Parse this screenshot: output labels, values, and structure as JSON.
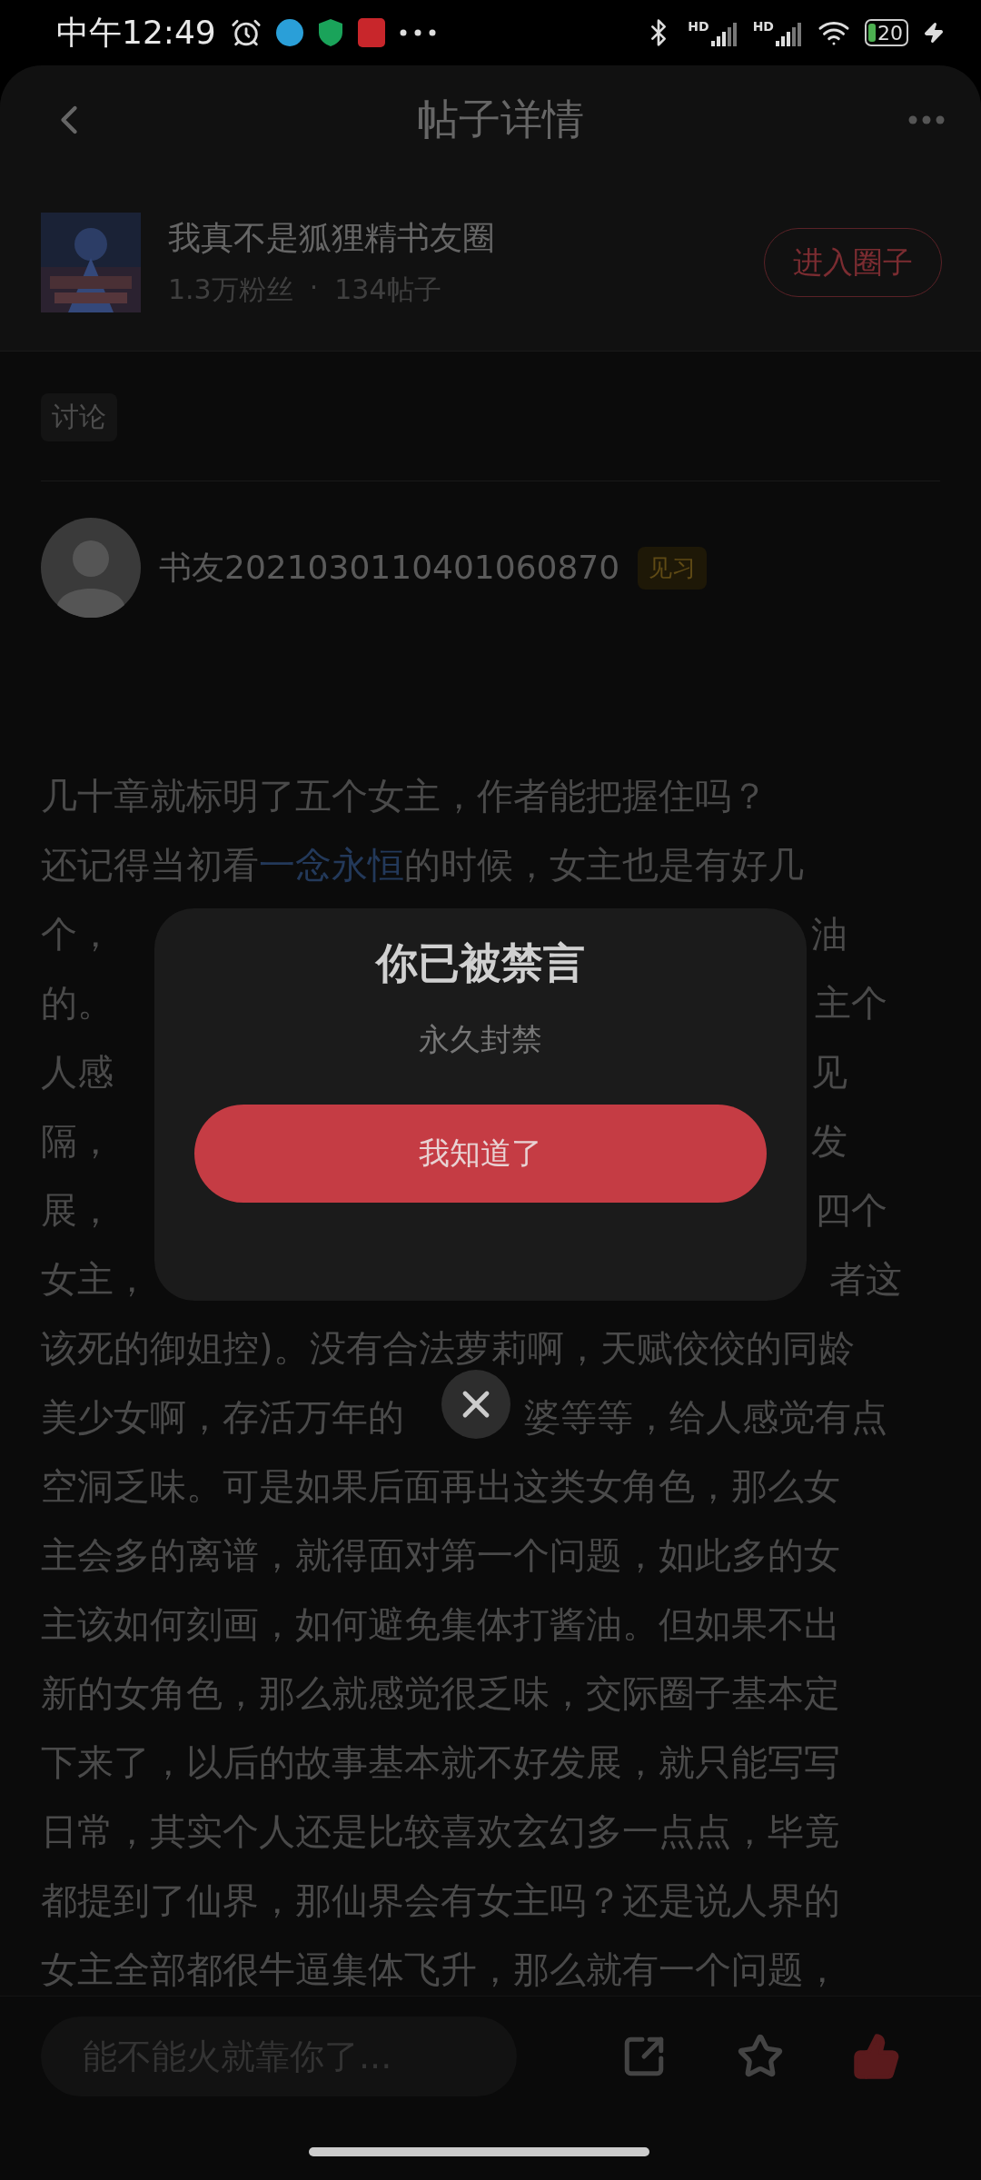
{
  "status_bar": {
    "time": "中午12:49",
    "signals": [
      {
        "label": "HD"
      },
      {
        "label": "HD"
      }
    ],
    "battery": "20"
  },
  "header": {
    "title": "帖子详情"
  },
  "circle": {
    "name": "我真不是狐狸精书友圈",
    "fans": "1.3万粉丝",
    "separator": "·",
    "posts": "134帖子",
    "join_button": "进入圈子"
  },
  "tag": "讨论",
  "author": {
    "name": "书友2021030110401060870",
    "badge": "见习"
  },
  "body_lines": [
    {
      "segments": [
        {
          "kind": "text",
          "text": "几十章就标明了五个女主，作者能把握住吗？"
        }
      ]
    },
    {
      "segments": [
        {
          "kind": "text",
          "text": "还记得当初看"
        },
        {
          "kind": "link",
          "text": "一念永恒"
        },
        {
          "kind": "text",
          "text": "的时候，女主也是有好几"
        }
      ]
    },
    {
      "segments": [
        {
          "kind": "text",
          "text": "个，"
        }
      ],
      "after_gap": "油"
    },
    {
      "segments": [
        {
          "kind": "text",
          "text": "的。"
        }
      ],
      "after_gap": "主个"
    },
    {
      "segments": [
        {
          "kind": "text",
          "text": "人感"
        }
      ],
      "after_gap": "见"
    },
    {
      "segments": [
        {
          "kind": "text",
          "text": "隔，"
        }
      ],
      "after_gap": "发"
    },
    {
      "segments": [
        {
          "kind": "text",
          "text": "展，"
        }
      ],
      "after_gap": "四个"
    },
    {
      "segments": [
        {
          "kind": "text",
          "text": "女主，"
        }
      ],
      "after_gap": "者这"
    },
    {
      "segments": [
        {
          "kind": "text",
          "text": "该死的御姐控)。没有合法萝莉啊，天赋佼佼的同龄"
        }
      ]
    },
    {
      "segments": [
        {
          "kind": "text",
          "text": "美少女啊，存活万年的"
        }
      ],
      "after_gap": "婆等等，给人感觉有点"
    },
    {
      "segments": [
        {
          "kind": "text",
          "text": "空洞乏味。可是如果后面再出这类女角色，那么女"
        }
      ]
    },
    {
      "segments": [
        {
          "kind": "text",
          "text": "主会多的离谱，就得面对第一个问题，如此多的女"
        }
      ]
    },
    {
      "segments": [
        {
          "kind": "text",
          "text": "主该如何刻画，如何避免集体打酱油。但如果不出"
        }
      ]
    },
    {
      "segments": [
        {
          "kind": "text",
          "text": "新的女角色，那么就感觉很乏味，交际圈子基本定"
        }
      ]
    },
    {
      "segments": [
        {
          "kind": "text",
          "text": "下来了，以后的故事基本就不好发展，就只能写写"
        }
      ]
    },
    {
      "segments": [
        {
          "kind": "text",
          "text": "日常，其实个人还是比较喜欢玄幻多一点点，毕竟"
        }
      ]
    },
    {
      "segments": [
        {
          "kind": "text",
          "text": "都提到了仙界，那仙界会有女主吗？还是说人界的"
        }
      ]
    },
    {
      "segments": [
        {
          "kind": "text",
          "text": "女主全部都很牛逼集体飞升，那么就有一个问题，"
        }
      ]
    }
  ],
  "comment_input": {
    "placeholder": "能不能火就靠你了..."
  },
  "actions": {
    "liked": true,
    "favorited": false
  },
  "dialog": {
    "title": "你已被禁言",
    "message": "永久封禁",
    "confirm": "我知道了"
  }
}
